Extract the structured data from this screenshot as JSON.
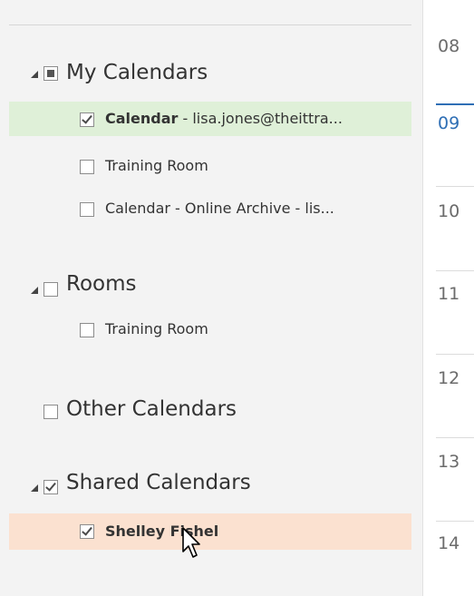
{
  "nav": {
    "my_calendars": {
      "label": "My Calendars",
      "items": [
        {
          "name_bold": "Calendar",
          "suffix": " - lisa.jones@theittra..."
        },
        {
          "label": "Training Room"
        },
        {
          "label": "Calendar - Online Archive - lis..."
        }
      ]
    },
    "rooms": {
      "label": "Rooms",
      "items": [
        {
          "label": "Training Room"
        }
      ]
    },
    "other_calendars": {
      "label": "Other Calendars"
    },
    "shared_calendars": {
      "label": "Shared Calendars",
      "items": [
        {
          "name_bold": "Shelley Fishel"
        }
      ]
    }
  },
  "timeline": {
    "hours": [
      "08",
      "09",
      "10",
      "11",
      "12",
      "13",
      "14"
    ],
    "current_hour": "09"
  },
  "colors": {
    "selected_green": "#dff0d8",
    "selected_shared": "#fbe1d0",
    "current_time_blue": "#2f6fb5"
  }
}
